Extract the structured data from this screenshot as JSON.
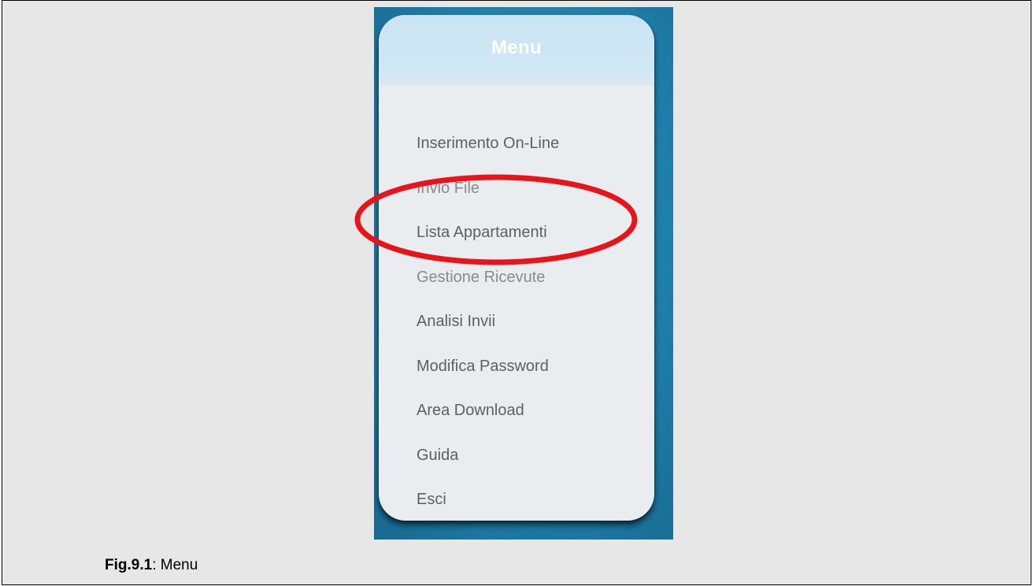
{
  "menu": {
    "title": "Menu",
    "items": [
      {
        "label": "Inserimento On-Line"
      },
      {
        "label": "Invio File"
      },
      {
        "label": "Lista Appartamenti"
      },
      {
        "label": "Gestione Ricevute"
      },
      {
        "label": "Analisi Invii"
      },
      {
        "label": "Modifica Password"
      },
      {
        "label": "Area Download"
      },
      {
        "label": "Guida"
      },
      {
        "label": "Esci"
      }
    ]
  },
  "annotation": {
    "highlighted_item": "Lista Appartamenti",
    "color": "#e8141b"
  },
  "caption": {
    "label": "Fig.9.1",
    "separator": ": ",
    "text": "Menu"
  },
  "colors": {
    "page_background": "#e7e7e7",
    "screenshot_background": "#1f7fab",
    "menu_header": "#c9e4f4",
    "menu_body": "#eaedef",
    "menu_item_text": "#5f5f5f"
  }
}
